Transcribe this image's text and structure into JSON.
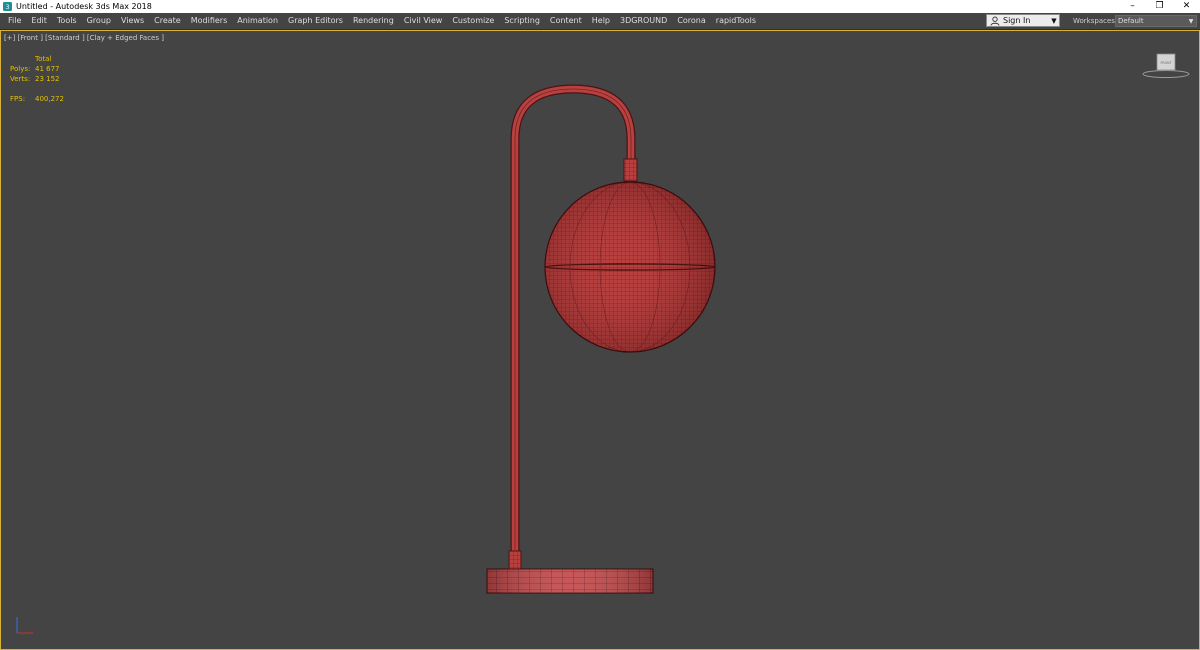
{
  "titlebar": {
    "title": "Untitled - Autodesk 3ds Max 2018",
    "app_icon": "3ds-max-icon",
    "minimize": "–",
    "restore": "❐",
    "close": "✕"
  },
  "menubar": {
    "items": [
      "File",
      "Edit",
      "Tools",
      "Group",
      "Views",
      "Create",
      "Modifiers",
      "Animation",
      "Graph Editors",
      "Rendering",
      "Civil View",
      "Customize",
      "Scripting",
      "Content",
      "Help",
      "3DGROUND",
      "Corona",
      "rapidTools"
    ],
    "signin_label": "Sign In",
    "workspaces_label": "Workspaces:",
    "workspaces_value": "Default"
  },
  "viewport": {
    "label": "[+] [Front ] [Standard ] [Clay + Edged Faces ]",
    "stats": {
      "header": "Total",
      "polys_label": "Polys:",
      "polys_value": "41 677",
      "verts_label": "Verts:",
      "verts_value": "23 152",
      "fps_label": "FPS:",
      "fps_value": "400,272"
    },
    "viewcube_label": "FRONT"
  },
  "colors": {
    "viewport_bg": "#444444",
    "active_border": "#d8b232",
    "stats_text": "#e3c200",
    "model_red": "#b8403f",
    "wire": "#4a1416"
  }
}
